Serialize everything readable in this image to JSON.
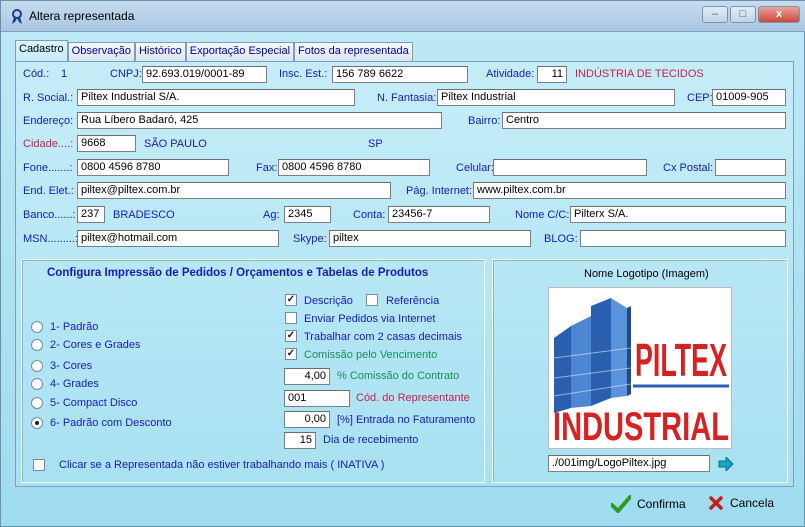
{
  "window": {
    "title": "Altera representada",
    "min": "–",
    "max": "□",
    "close": "x"
  },
  "tabs": [
    "Cadastro",
    "Observação",
    "Histórico",
    "Exportação Especial",
    "Fotos da representada"
  ],
  "form": {
    "cod_label": "Cód.:",
    "cod_value": "1",
    "cnpj_label": "CNPJ:",
    "cnpj_value": "92.693.019/0001-89",
    "insc_label": "Insc. Est.:",
    "insc_value": "156 789 6622",
    "atividade_label": "Atividade:",
    "atividade_code": "11",
    "atividade_name": "INDÚSTRIA DE TECIDOS",
    "razao_label": "R. Social.:",
    "razao_value": "Piltex Industrial S/A.",
    "fantasia_label": "N. Fantasia:",
    "fantasia_value": "Piltex Industrial",
    "cep_label": "CEP:",
    "cep_value": "01009-905",
    "endereco_label": "Endereço:",
    "endereco_value": "Rua Líbero Badaró, 425",
    "bairro_label": "Bairro:",
    "bairro_value": "Centro",
    "cidade_label": "Cidade....:",
    "cidade_code": "9668",
    "cidade_name": "SÃO PAULO",
    "uf": "SP",
    "fone_label": "Fone.......:",
    "fone_value": "0800 4596 8780",
    "fax_label": "Fax:",
    "fax_value": "0800 4596 8780",
    "celular_label": "Celular:",
    "celular_value": "",
    "cxpostal_label": "Cx Postal:",
    "cxpostal_value": "",
    "email_label": "End. Elet.:",
    "email_value": "piltex@piltex.com.br",
    "internet_label": "Pág. Internet:",
    "internet_value": "www.piltex.com.br",
    "banco_label": "Banco......:",
    "banco_code": "237",
    "banco_name": "BRADESCO",
    "ag_label": "Ag:",
    "ag_value": "2345",
    "conta_label": "Conta:",
    "conta_value": "23456-7",
    "nomecc_label": "Nome C/C:",
    "nomecc_value": "Pilterx S/A.",
    "msn_label": "MSN.........:",
    "msn_value": "piltex@hotmail.com",
    "skype_label": "Skype:",
    "skype_value": "piltex",
    "blog_label": "BLOG:",
    "blog_value": ""
  },
  "config": {
    "title": "Configura Impressão  de Pedidos / Orçamentos  e Tabelas de Produtos",
    "radios": [
      "1- Padrão",
      "2- Cores e Grades",
      "3- Cores",
      "4- Grades",
      "5- Compact Disco",
      "6- Padrão com Desconto"
    ],
    "selected_radio": "6- Padrão com Desconto",
    "descricao": "Descrição",
    "referencia": "Referência",
    "enviar": "Enviar Pedidos via Internet",
    "trabalhar": "Trabalhar com 2 casas decimais",
    "comissao_venc": "Comissão pelo Vencimento",
    "comissao_value": "4,00",
    "comissao_label": "% Comissão do Contrato",
    "cod_repr_value": "001",
    "cod_repr_label": "Cód. do Representante",
    "entrada_value": "0,00",
    "entrada_label": "[%] Entrada no Faturamento",
    "dia_value": "15",
    "dia_label": "Dia de recebimento",
    "inativa": "Clicar se a Representada não estiver trabalhando mais ( INATIVA )",
    "check_mark": "✓"
  },
  "logo": {
    "title": "Nome Logotipo (Imagem)",
    "line1": "PILTEX",
    "line2": "INDUSTRIAL",
    "path": "./001img/LogoPiltex.jpg"
  },
  "actions": {
    "confirm": "Confirma",
    "cancel": "Cancela"
  },
  "colors": {
    "label_blue": "#1a1ab8",
    "logo_red": "#d62222",
    "logo_blue": "#2a5fb0"
  }
}
